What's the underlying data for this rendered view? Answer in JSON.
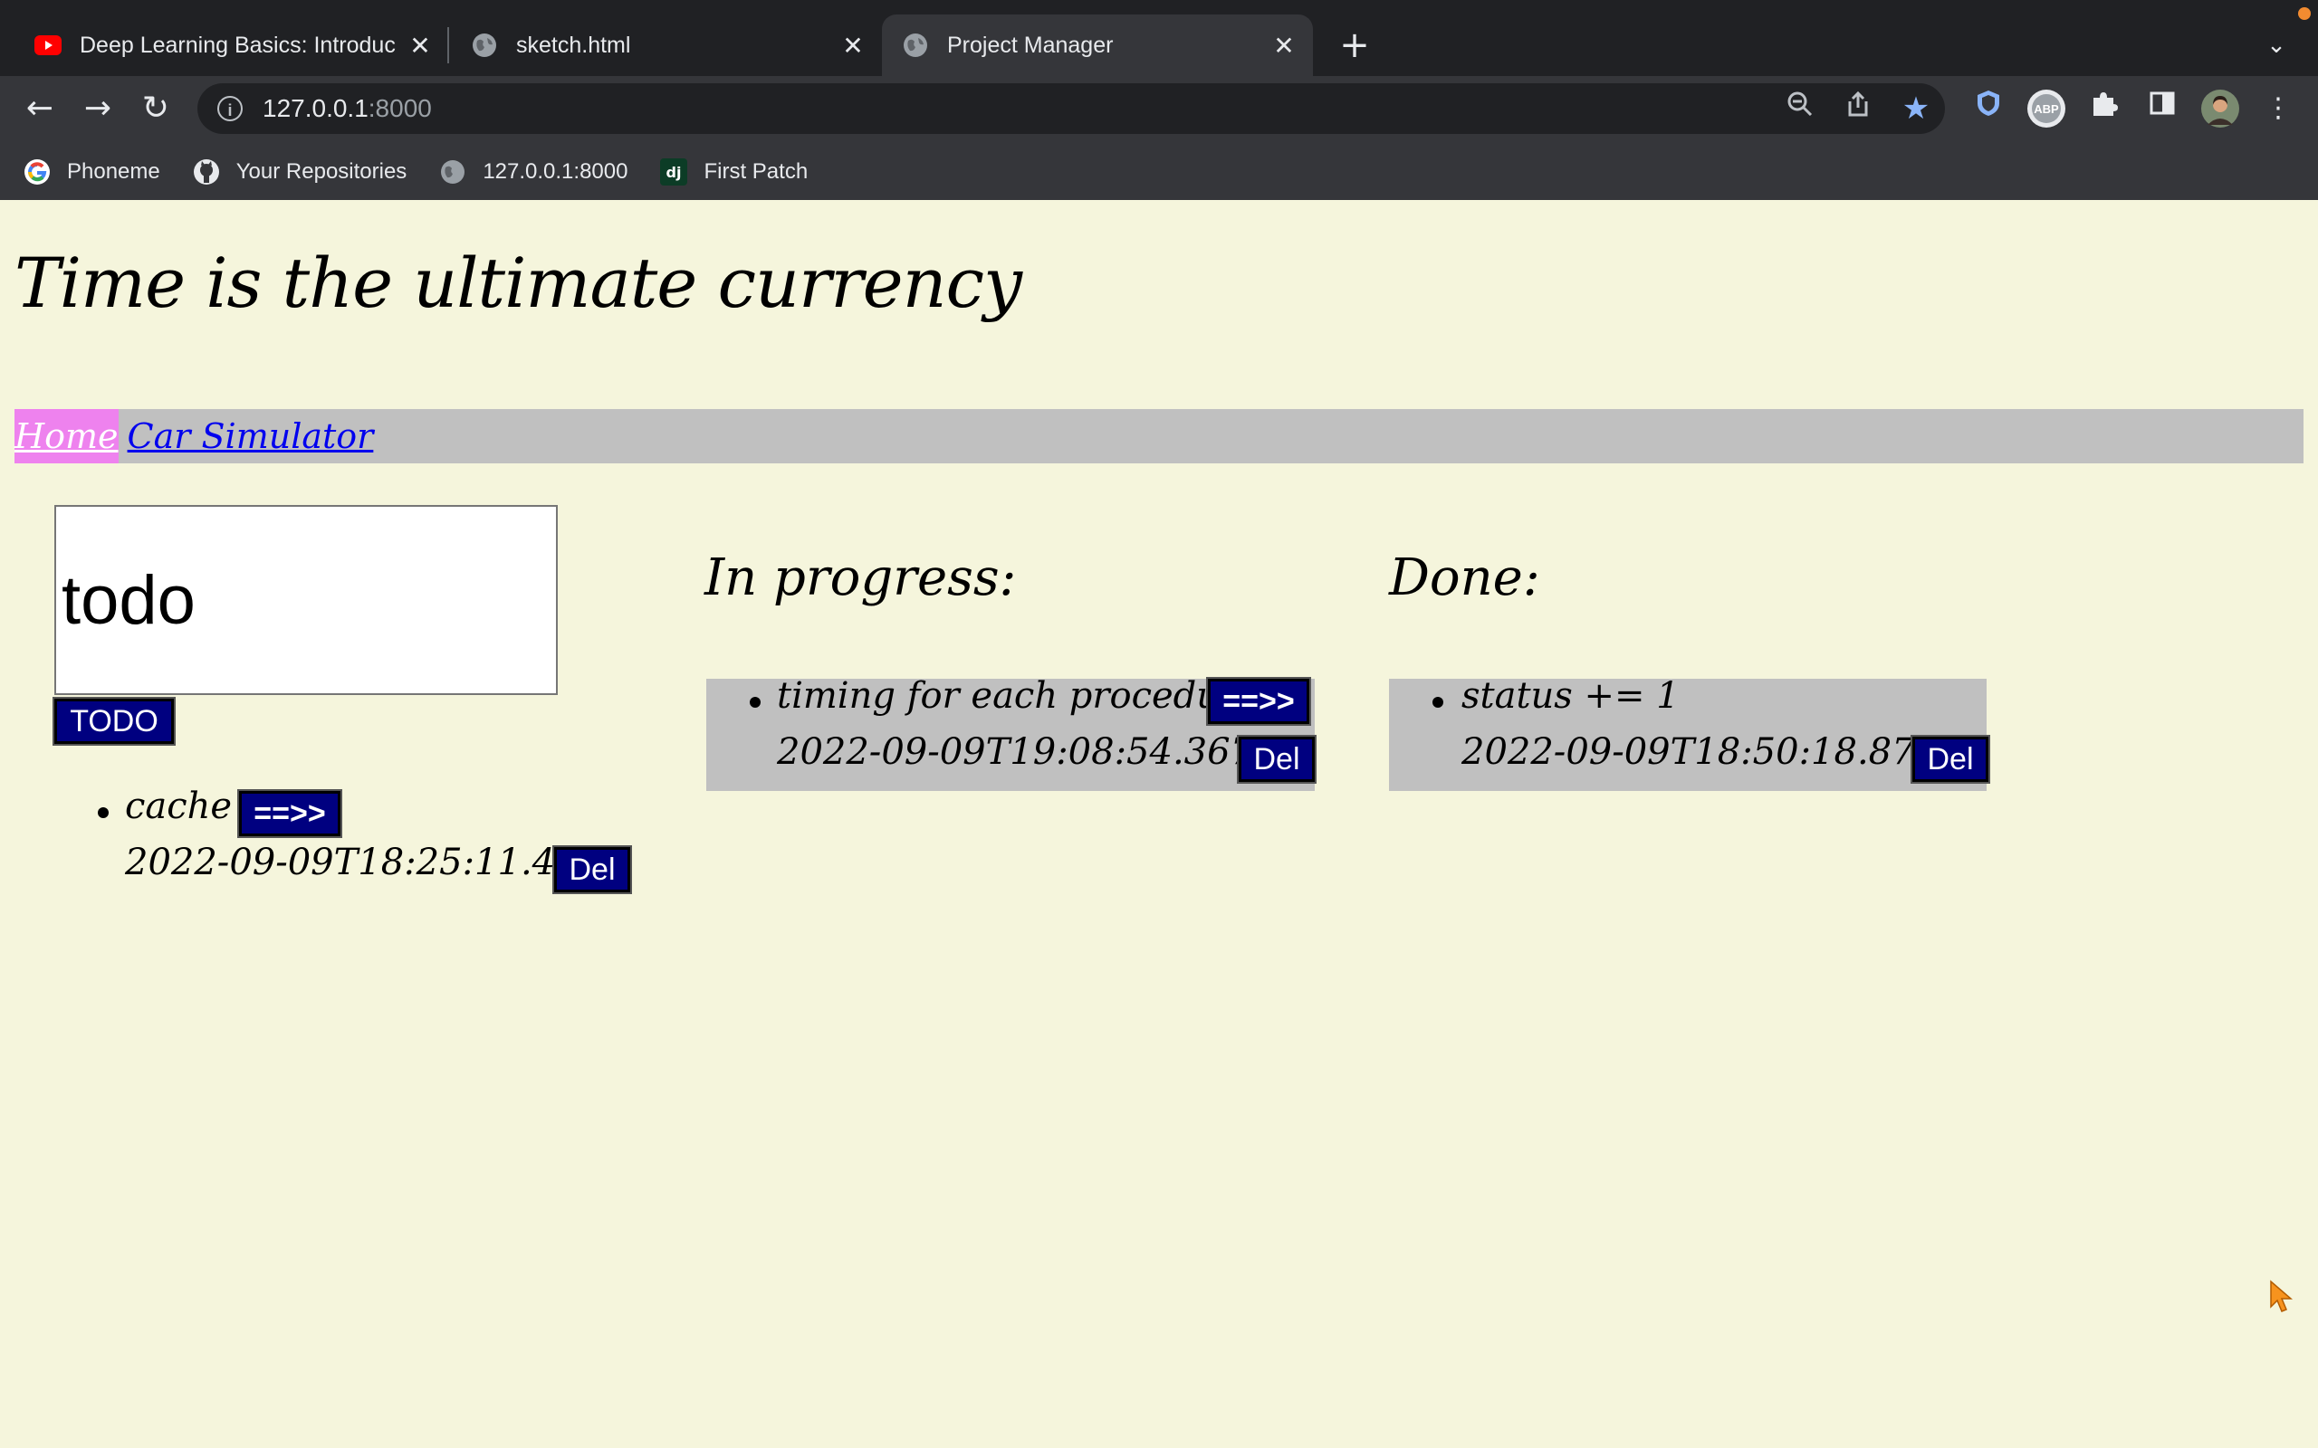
{
  "browser": {
    "tabs": [
      {
        "title": "Deep Learning Basics: Introduc",
        "favicon": "youtube-icon",
        "active": false
      },
      {
        "title": "sketch.html",
        "favicon": "globe-icon",
        "active": false
      },
      {
        "title": "Project Manager",
        "favicon": "globe-icon",
        "active": true
      }
    ],
    "new_tab": "+",
    "url_host": "127.0.0.1",
    "url_port": ":8000",
    "bookmarks": [
      {
        "label": "Phoneme",
        "icon": "google-icon"
      },
      {
        "label": "Your Repositories",
        "icon": "github-icon"
      },
      {
        "label": "127.0.0.1:8000",
        "icon": "globe-icon"
      },
      {
        "label": "First Patch",
        "icon": "django-icon"
      }
    ],
    "extension_badge": "ABP"
  },
  "page": {
    "title": "Time is the ultimate currency",
    "nav": {
      "home": "Home",
      "car_simulator": "Car Simulator"
    },
    "todo": {
      "input_value": "todo",
      "add_button": "TODO",
      "items": [
        {
          "text": "cache",
          "timestamp": "2022-09-09T18:25:11.481Z",
          "move_label": "==>>",
          "del_label": "Del"
        }
      ]
    },
    "in_progress": {
      "heading": "In progress:",
      "items": [
        {
          "text": "timing for each procedure",
          "timestamp": "2022-09-09T19:08:54.367Z",
          "move_label": "==>>",
          "del_label": "Del"
        }
      ]
    },
    "done": {
      "heading": "Done:",
      "items": [
        {
          "text": "status += 1",
          "timestamp": "2022-09-09T18:50:18.870Z",
          "del_label": "Del"
        }
      ]
    }
  },
  "colors": {
    "page_bg": "#f5f5dc",
    "button_bg": "#000080",
    "nav_bg": "#c0c0c0",
    "nav_active": "#ee82ee",
    "link": "#0000ee"
  }
}
